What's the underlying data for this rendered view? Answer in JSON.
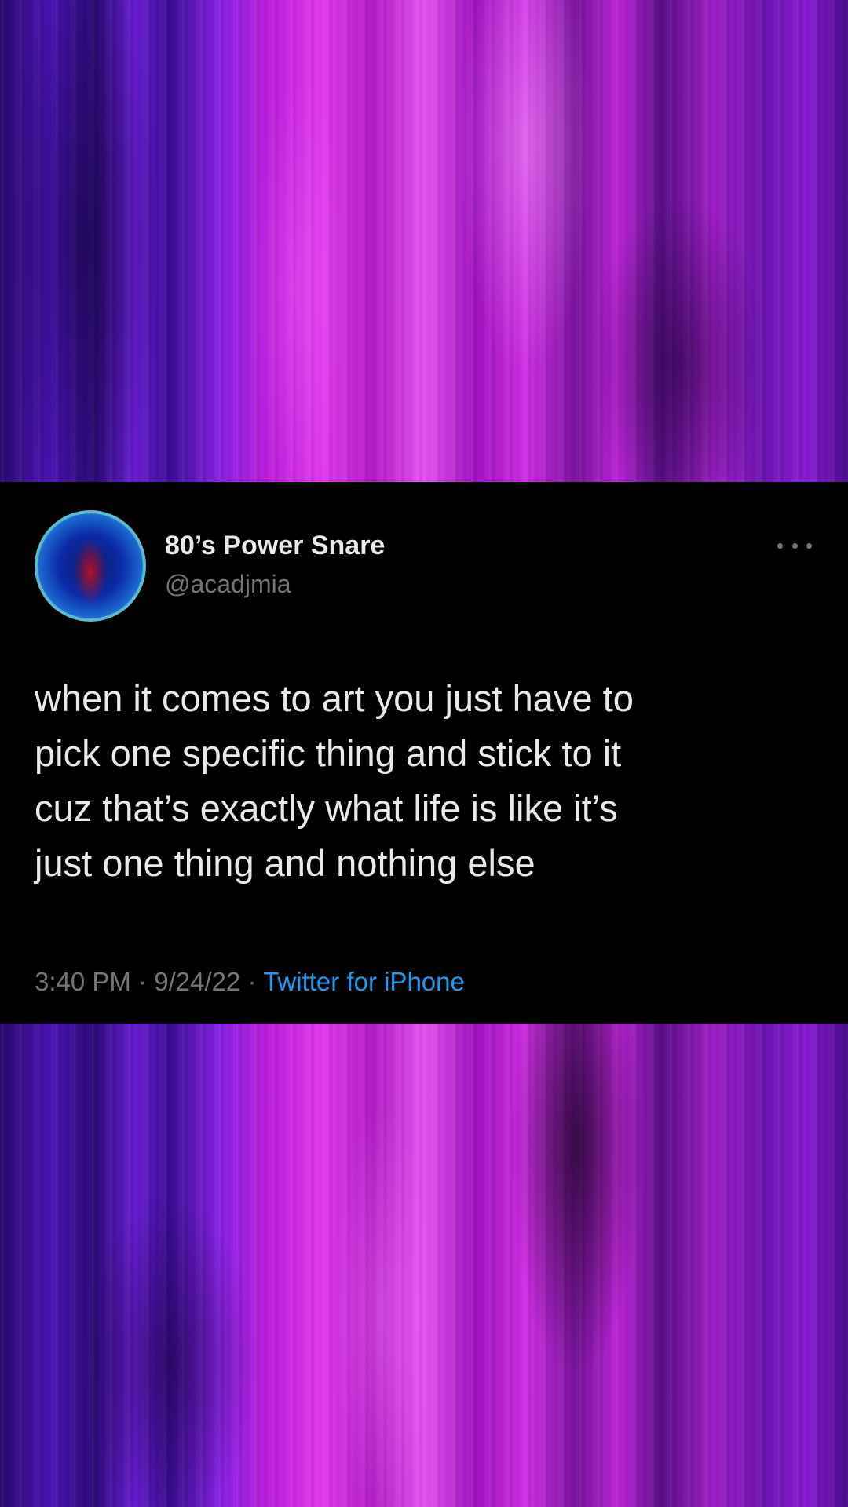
{
  "tweet": {
    "display_name": "80’s Power Snare",
    "handle": "@acadjmia",
    "text": "when it comes to art you just have to\npick one specific thing and stick to it\ncuz that’s exactly what life is like it’s\njust one thing and nothing else",
    "time": "3:40 PM",
    "separator": " · ",
    "date": "9/24/22",
    "source": "Twitter for iPhone",
    "more_icon": "more-horizontal-icon",
    "avatar_icon": "profile-avatar"
  },
  "colors": {
    "background_panels": "#9b1fd8",
    "card_background": "#000000",
    "primary_text": "#e7e9ea",
    "secondary_text": "#71767b",
    "link": "#1d9bf0"
  }
}
